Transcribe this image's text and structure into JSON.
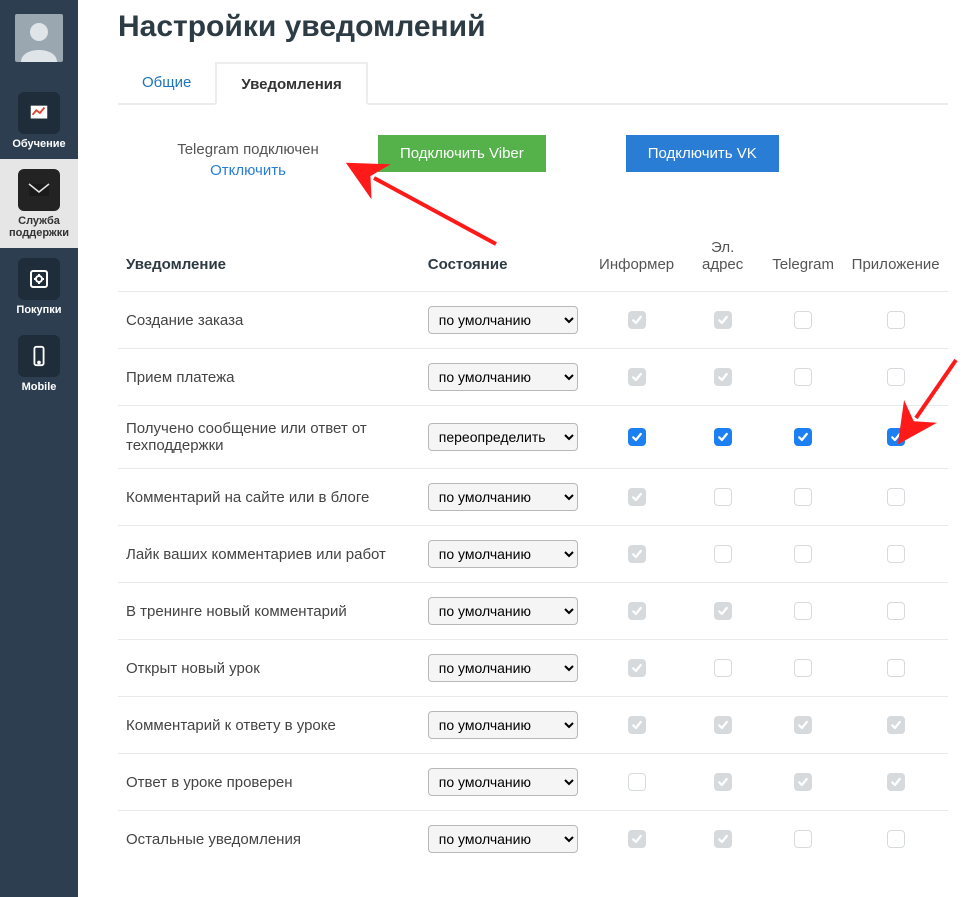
{
  "sidebar": {
    "items": [
      {
        "id": "learning",
        "label": "Обучение",
        "active": false,
        "icon": "chart"
      },
      {
        "id": "support",
        "label": "Служба поддержки",
        "active": true,
        "icon": "mail"
      },
      {
        "id": "purchases",
        "label": "Покупки",
        "active": false,
        "icon": "safe"
      },
      {
        "id": "mobile",
        "label": "Mobile",
        "active": false,
        "icon": "phone"
      }
    ]
  },
  "page": {
    "title": "Настройки уведомлений"
  },
  "tabs": [
    {
      "id": "general",
      "label": "Общие",
      "active": false
    },
    {
      "id": "notifications",
      "label": "Уведомления",
      "active": true
    }
  ],
  "telegram": {
    "status": "Telegram подключен",
    "disconnect": "Отключить"
  },
  "buttons": {
    "viber": "Подключить Viber",
    "vk": "Подключить VK"
  },
  "table": {
    "headers": {
      "name": "Уведомление",
      "state": "Состояние",
      "informer": "Информер",
      "email": "Эл. адрес",
      "telegram": "Telegram",
      "app": "Приложение"
    },
    "state_options": {
      "default": "по умолчанию",
      "override": "переопределить"
    },
    "rows": [
      {
        "name": "Создание заказа",
        "state": "default",
        "c": [
          {
            "s": "dc"
          },
          {
            "s": "dc"
          },
          {
            "s": "du"
          },
          {
            "s": "du"
          }
        ]
      },
      {
        "name": "Прием платежа",
        "state": "default",
        "c": [
          {
            "s": "dc"
          },
          {
            "s": "dc"
          },
          {
            "s": "du"
          },
          {
            "s": "du"
          }
        ]
      },
      {
        "name": "Получено сообщение или ответ от техподдержки",
        "state": "override",
        "c": [
          {
            "s": "ec"
          },
          {
            "s": "ec"
          },
          {
            "s": "ec"
          },
          {
            "s": "ec"
          }
        ]
      },
      {
        "name": "Комментарий на сайте или в блоге",
        "state": "default",
        "c": [
          {
            "s": "dc"
          },
          {
            "s": "du"
          },
          {
            "s": "du"
          },
          {
            "s": "du"
          }
        ]
      },
      {
        "name": "Лайк ваших комментариев или работ",
        "state": "default",
        "c": [
          {
            "s": "dc"
          },
          {
            "s": "du"
          },
          {
            "s": "du"
          },
          {
            "s": "du"
          }
        ]
      },
      {
        "name": "В тренинге новый комментарий",
        "state": "default",
        "c": [
          {
            "s": "dc"
          },
          {
            "s": "dc"
          },
          {
            "s": "du"
          },
          {
            "s": "du"
          }
        ]
      },
      {
        "name": "Открыт новый урок",
        "state": "default",
        "c": [
          {
            "s": "dc"
          },
          {
            "s": "du"
          },
          {
            "s": "du"
          },
          {
            "s": "du"
          }
        ]
      },
      {
        "name": "Комментарий к ответу в уроке",
        "state": "default",
        "c": [
          {
            "s": "dc"
          },
          {
            "s": "dc"
          },
          {
            "s": "dc"
          },
          {
            "s": "dc"
          }
        ]
      },
      {
        "name": "Ответ в уроке проверен",
        "state": "default",
        "c": [
          {
            "s": "du"
          },
          {
            "s": "dc"
          },
          {
            "s": "dc"
          },
          {
            "s": "dc"
          }
        ]
      },
      {
        "name": "Остальные уведомления",
        "state": "default",
        "c": [
          {
            "s": "dc"
          },
          {
            "s": "dc"
          },
          {
            "s": "du"
          },
          {
            "s": "du"
          }
        ]
      }
    ]
  }
}
